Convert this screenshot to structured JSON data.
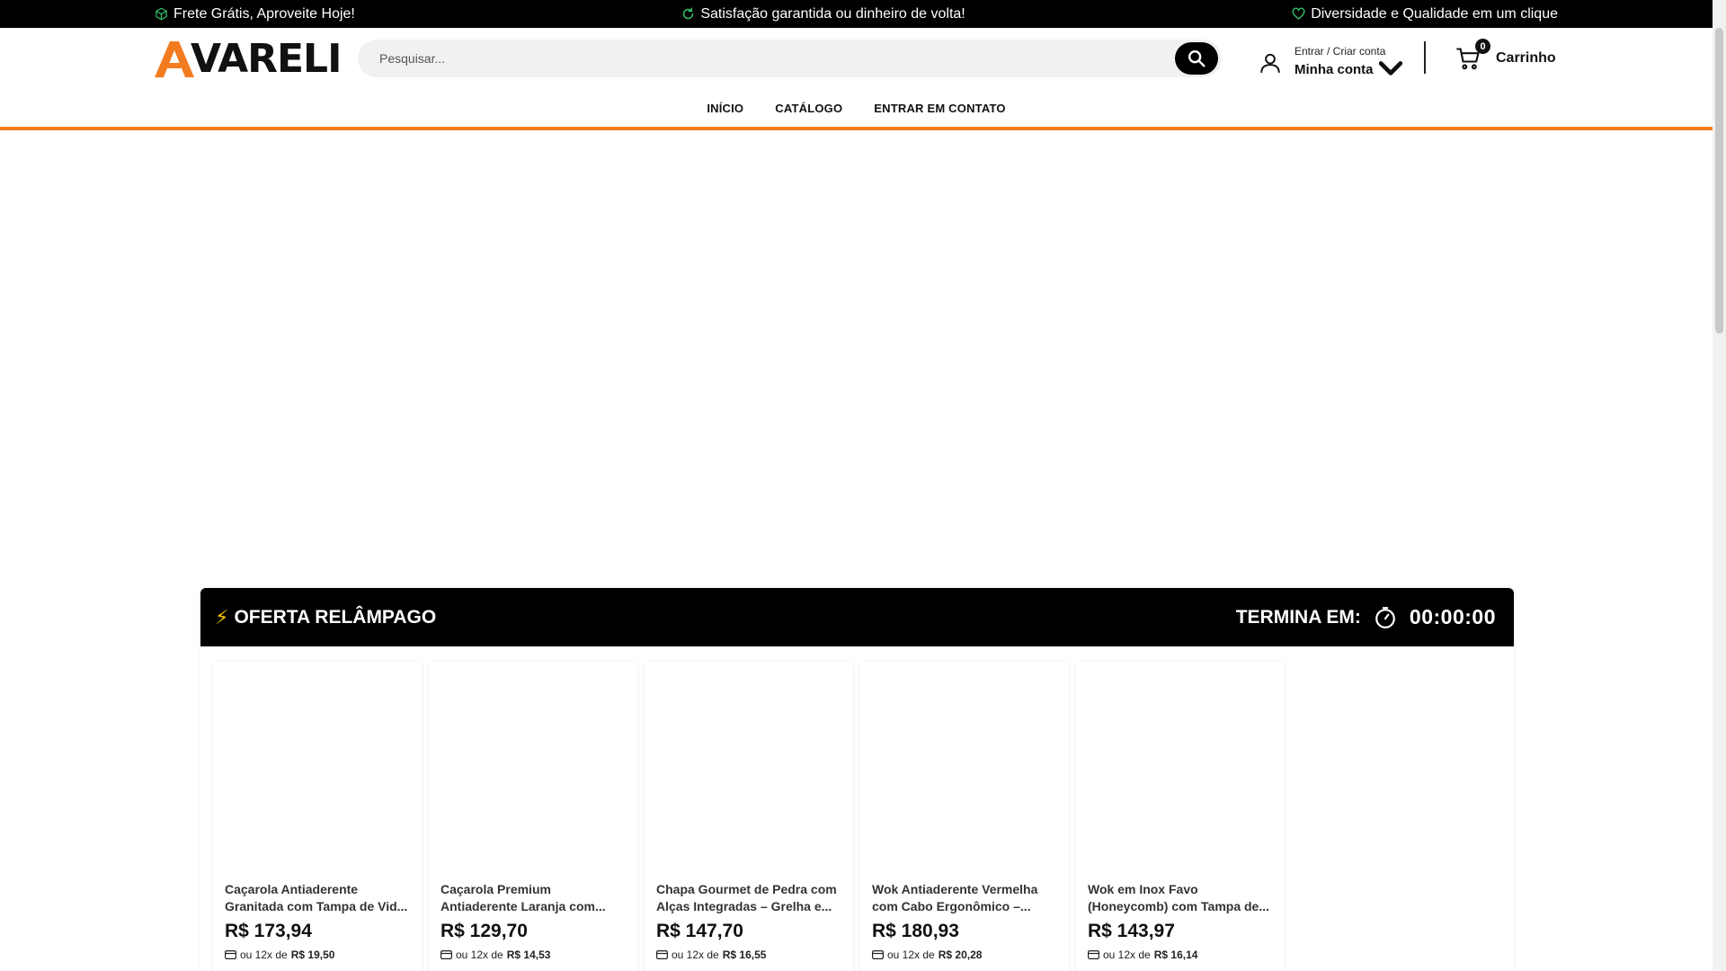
{
  "topbar": {
    "promos": [
      {
        "icon": "box-icon",
        "text": "Frete Grátis, Aproveite Hoje!"
      },
      {
        "icon": "refresh-icon",
        "text": "Satisfação garantida ou dinheiro de volta!"
      },
      {
        "icon": "heart-icon",
        "text": "Diversidade e Qualidade em um clique"
      }
    ],
    "icon_color": "#34c46a"
  },
  "header": {
    "logo_text": "VARELI",
    "logo_accent": "#f47c20",
    "search_placeholder": "Pesquisar...",
    "account_small": "Entrar / Criar conta",
    "account_big": "Minha conta",
    "cart_count": "0",
    "cart_label": "Carrinho"
  },
  "nav": {
    "items": [
      "INÍCIO",
      "CATÁLOGO",
      "ENTRAR EM CONTATO"
    ]
  },
  "flash_sale": {
    "title": "OFERTA RELÂMPAGO",
    "ends_label": "TERMINA EM:",
    "timer": "00:00:00",
    "products": [
      {
        "name": "Caçarola Antiaderente Granitada com Tampa de Vid...",
        "price": "R$ 173,94",
        "inst_prefix": "ou 12x de",
        "inst_value": "R$ 19,50"
      },
      {
        "name": "Caçarola Premium Antiaderente Laranja com...",
        "price": "R$ 129,70",
        "inst_prefix": "ou 12x de",
        "inst_value": "R$ 14,53"
      },
      {
        "name": "Chapa Gourmet de Pedra com Alças Integradas – Grelha e...",
        "price": "R$ 147,70",
        "inst_prefix": "ou 12x de",
        "inst_value": "R$ 16,55"
      },
      {
        "name": "Wok Antiaderente Vermelha com Cabo Ergonômico –...",
        "price": "R$ 180,93",
        "inst_prefix": "ou 12x de",
        "inst_value": "R$ 20,28"
      },
      {
        "name": "Wok em Inox Favo (Honeycomb) com Tampa de...",
        "price": "R$ 143,97",
        "inst_prefix": "ou 12x de",
        "inst_value": "R$ 16,14"
      }
    ]
  }
}
